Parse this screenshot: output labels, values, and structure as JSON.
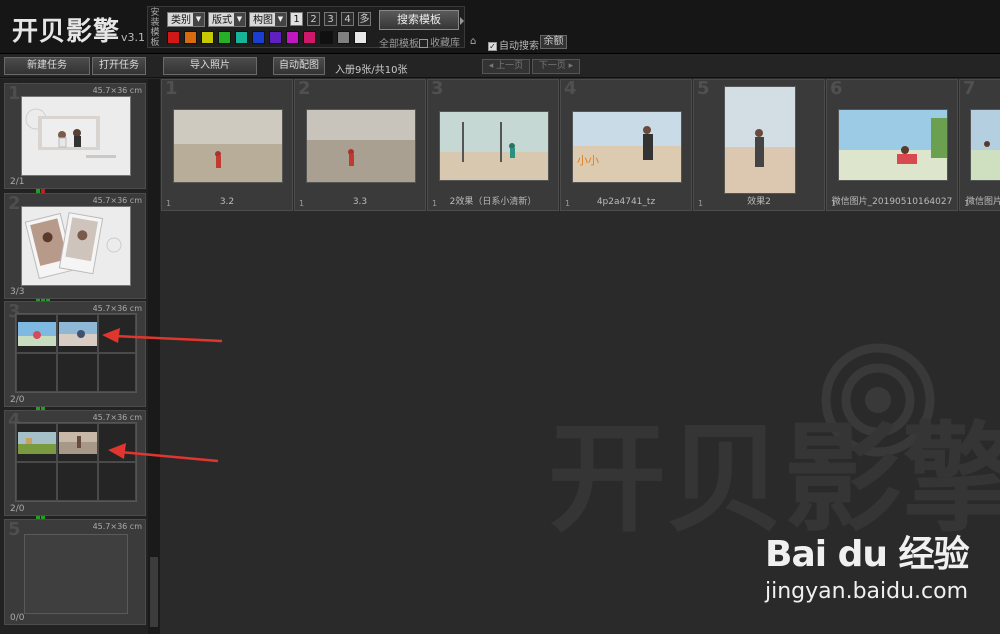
{
  "app": {
    "logo_text": "开贝影擎",
    "version": "v3.1"
  },
  "template_panel": {
    "vertical_label": "安装模板",
    "dropdowns": [
      {
        "label": "类别"
      },
      {
        "label": "版式"
      },
      {
        "label": "构图"
      }
    ],
    "number_buttons": [
      "1",
      "2",
      "3",
      "4",
      "多"
    ],
    "active_number": "1",
    "color_swatches": [
      "#d01818",
      "#d86a10",
      "#c8c800",
      "#25b025",
      "#18b49a",
      "#1a3fd0",
      "#6020c0",
      "#c018c0",
      "#d0186a",
      "#101010",
      "#808080",
      "#e8e8e8"
    ],
    "search_label": "搜索模板",
    "all_templates": "全部模板",
    "favorites": "收藏库",
    "auto_search": "自动搜索",
    "balance": "余额"
  },
  "toolbar": {
    "new_task": "新建任务",
    "open_task": "打开任务",
    "import_photos": "导入照片",
    "auto_match": "自动配图",
    "album_info": "入册9张/共10张",
    "prev_page": "◂ 上一页",
    "next_page": "下一页 ▸"
  },
  "tasks": [
    {
      "num": "1",
      "size": "45.7×36 cm",
      "count": "2/1"
    },
    {
      "num": "2",
      "size": "45.7×36 cm",
      "count": "3/3"
    },
    {
      "num": "3",
      "size": "45.7×36 cm",
      "count": "2/0"
    },
    {
      "num": "4",
      "size": "45.7×36 cm",
      "count": "2/0"
    },
    {
      "num": "5",
      "size": "45.7×36 cm",
      "count": "0/0"
    }
  ],
  "photos": [
    {
      "num": "1",
      "label": "3.2",
      "index": "1"
    },
    {
      "num": "2",
      "label": "3.3",
      "index": "1"
    },
    {
      "num": "3",
      "label": "2效果（日系小清新）",
      "index": "1"
    },
    {
      "num": "4",
      "label": "4p2a4741_tz",
      "index": "1"
    },
    {
      "num": "5",
      "label": "效果2",
      "index": "1"
    },
    {
      "num": "6",
      "label": "微信图片_20190510164027",
      "index": "1"
    },
    {
      "num": "7",
      "label": "微信图片",
      "index": "1"
    }
  ],
  "watermark": {
    "logo": "开贝影擎",
    "baidu": "Bai du 经验",
    "baidu_url": "jingyan.baidu.com"
  }
}
